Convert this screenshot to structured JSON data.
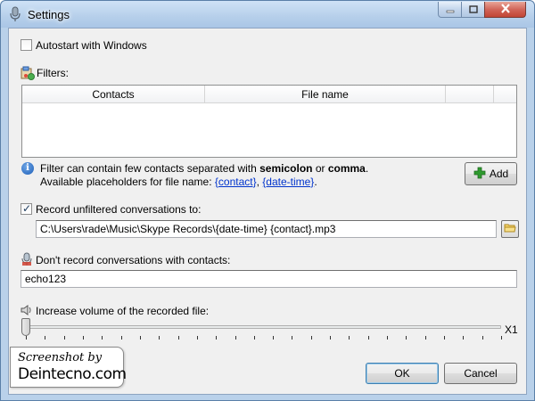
{
  "window": {
    "title": "Settings",
    "controls": {
      "minimize": "minimize",
      "maximize": "maximize",
      "close": "close"
    }
  },
  "autostart": {
    "label": "Autostart with Windows",
    "checked": false
  },
  "filters": {
    "label": "Filters:",
    "columns": [
      "Contacts",
      "File name",
      "",
      ""
    ],
    "rows": []
  },
  "info": {
    "line1_prefix": "Filter can contain few contacts separated with ",
    "line1_bold1": "semicolon",
    "line1_mid": " or ",
    "line1_bold2": "comma",
    "line1_suffix": ".",
    "line2_prefix": "Available placeholders for file name: ",
    "placeholder1": "{contact}",
    "sep": ", ",
    "placeholder2": "{date-time}",
    "line2_suffix": "."
  },
  "add_button": {
    "label": "Add"
  },
  "record_unfiltered": {
    "label": "Record unfiltered conversations to:",
    "checked": true,
    "path": "C:\\Users\\rade\\Music\\Skype Records\\{date-time} {contact}.mp3"
  },
  "dont_record": {
    "label": "Don't record conversations with contacts:",
    "value": "echo123"
  },
  "volume": {
    "label": "Increase volume of the recorded file:",
    "level_label": "X1",
    "level": 0
  },
  "watermark": {
    "line1": "Screenshot by",
    "line2": "Deintecno.com"
  },
  "buttons": {
    "ok": "OK",
    "cancel": "Cancel"
  },
  "colors": {
    "title_bar": "#b9d1ea",
    "close_button": "#c24535",
    "link": "#0033cc",
    "add_icon": "#2e9a2e"
  },
  "icons": {
    "app": "microphone-icon",
    "filters": "filter-icon",
    "info": "info-icon",
    "add": "plus-icon",
    "folder": "folder-icon",
    "mute": "muted-microphone-icon",
    "volume": "speaker-icon"
  }
}
